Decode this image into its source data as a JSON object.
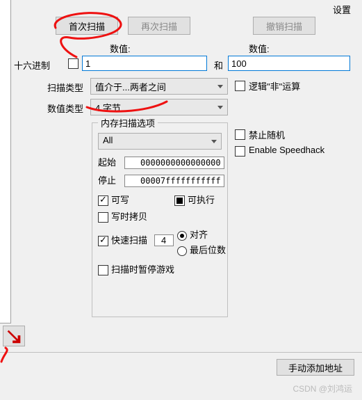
{
  "header": {
    "settings": "设置"
  },
  "buttons": {
    "first_scan": "首次扫描",
    "next_scan": "再次扫描",
    "undo_scan": "撤销扫描",
    "manual_add": "手动添加地址"
  },
  "labels": {
    "value1": "数值:",
    "value2": "数值:",
    "hex": "十六进制",
    "and": "和",
    "scan_type": "扫描类型",
    "value_type": "数值类型",
    "not_op": "逻辑\"非\"运算",
    "mem_group": "内存扫描选项",
    "start": "起始",
    "stop": "停止",
    "writable": "可写",
    "executable": "可执行",
    "copy_on_write": "写时拷贝",
    "fast_scan": "快速扫描",
    "align": "对齐",
    "last_digits": "最后位数",
    "pause": "扫描时暂停游戏",
    "no_random": "禁止随机",
    "speedhack": "Enable Speedhack"
  },
  "values": {
    "val1": "1",
    "val2": "100",
    "scan_type": "值介于...两者之间",
    "value_type": "4 字节",
    "mem_option": "All",
    "addr_start": "0000000000000000",
    "addr_stop": "00007fffffffffff",
    "fast_align": "4"
  },
  "checks": {
    "hex": false,
    "not": false,
    "writable": true,
    "executable": "mixed",
    "cow": false,
    "fast": true,
    "align": true,
    "last": false,
    "pause": false,
    "rand": false,
    "speed": false
  },
  "watermark": "CSDN @刘鸿运"
}
